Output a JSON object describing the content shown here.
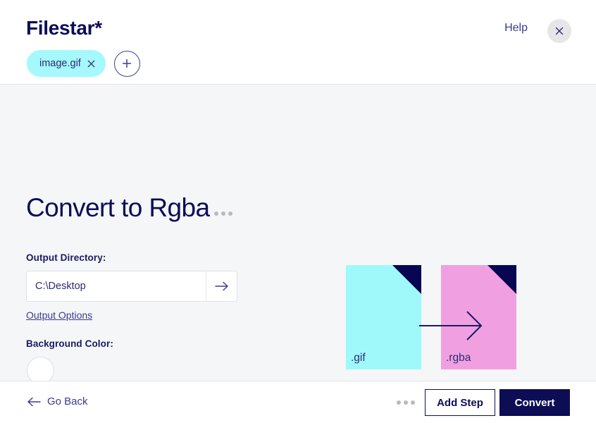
{
  "header": {
    "brand_name": "Filestar",
    "brand_star": "*",
    "help_label": "Help",
    "close_icon": "close-x-icon",
    "tabs": [
      {
        "label": "image.gif",
        "close_icon": "close-x-icon"
      }
    ],
    "add_tab_icon": "plus-icon"
  },
  "main": {
    "title": "Convert to Rgba",
    "title_menu_icon": "ellipsis-icon",
    "output_directory_label": "Output Directory:",
    "output_directory_value": "C:\\Desktop",
    "output_directory_placeholder": "C:\\Desktop",
    "directory_go_icon": "arrow-right-icon",
    "output_options_label": "Output Options",
    "background_color_label": "Background Color:",
    "background_color_value": "#ffffff"
  },
  "illustration": {
    "source_ext": ".gif",
    "source_color": "#9ff9fb",
    "target_ext": ".rgba",
    "target_color": "#f0a0e0",
    "arrow_icon": "arrow-right-icon",
    "fold_color": "#060652"
  },
  "footer": {
    "go_back_label": "Go Back",
    "go_back_icon": "arrow-left-icon",
    "more_icon": "ellipsis-icon",
    "add_step_label": "Add Step",
    "convert_label": "Convert"
  }
}
